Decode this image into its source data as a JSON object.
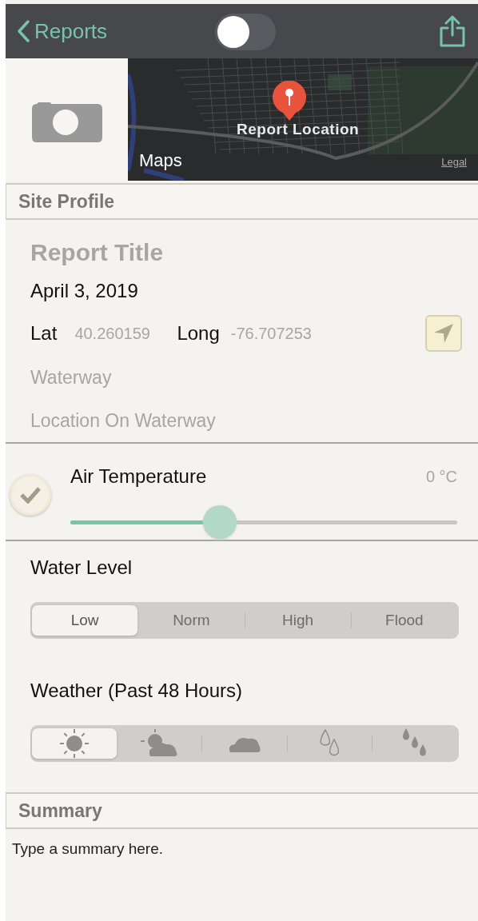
{
  "nav": {
    "back_label": "Reports",
    "toggle": {
      "on": false
    }
  },
  "map": {
    "pin_label": "Report Location",
    "brand": "Maps",
    "legal": "Legal"
  },
  "site_profile": {
    "header": "Site Profile",
    "title_field": {
      "placeholder": "Report Title"
    },
    "date": "April 3, 2019",
    "lat_label": "Lat",
    "lat_value": "40.260159",
    "long_label": "Long",
    "long_value": "-76.707253",
    "waterway_field": {
      "placeholder": "Waterway"
    },
    "location_field": {
      "placeholder": "Location On Waterway"
    }
  },
  "air_temperature": {
    "label": "Air Temperature",
    "checked": true,
    "level": 0.386,
    "reading": "0 °C"
  },
  "water_level": {
    "label": "Water Level",
    "segments": [
      {
        "label": "Low",
        "selected": true
      },
      {
        "label": "Norm",
        "selected": false
      },
      {
        "label": "High",
        "selected": false
      },
      {
        "label": "Flood",
        "selected": false
      }
    ]
  },
  "weather": {
    "label": "Weather (Past 48 Hours)",
    "segments": [
      {
        "kind": "sunny",
        "selected": true
      },
      {
        "kind": "partly",
        "selected": false
      },
      {
        "kind": "cloudy",
        "selected": false
      },
      {
        "kind": "drizzle",
        "selected": false
      },
      {
        "kind": "rain",
        "selected": false
      }
    ]
  },
  "summary": {
    "header": "Summary",
    "placeholder": "Type a summary here."
  }
}
